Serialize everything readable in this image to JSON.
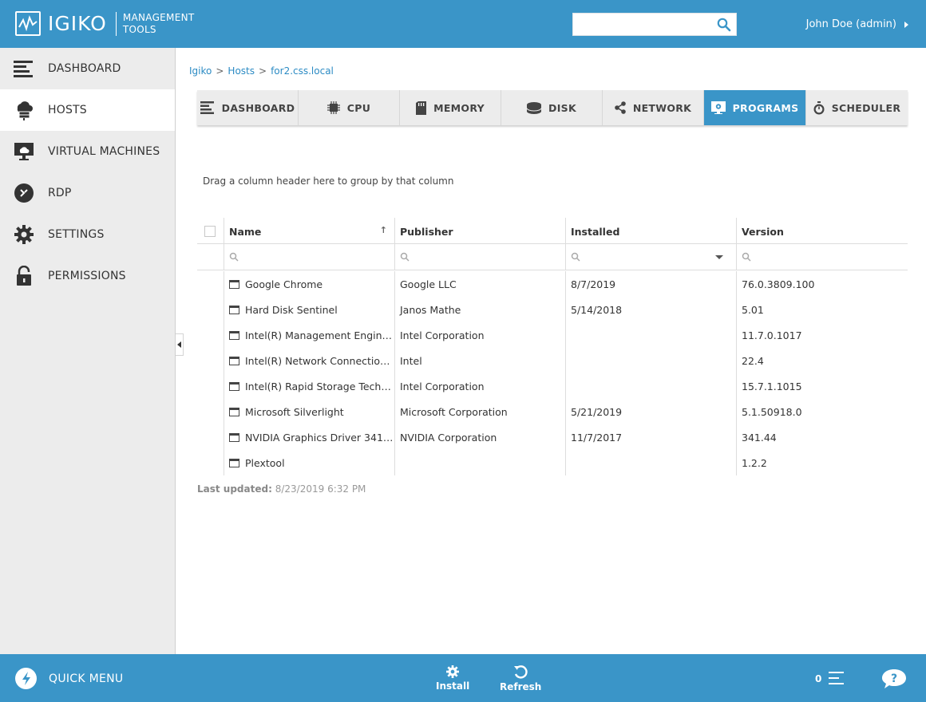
{
  "header": {
    "logo_text": "IGIKO",
    "logo_sub_line1": "MANAGEMENT",
    "logo_sub_line2": "TOOLS",
    "search_placeholder": "",
    "user": "John Doe (admin)"
  },
  "sidebar": {
    "items": [
      {
        "label": "DASHBOARD",
        "icon": "dashboard-icon",
        "active": false
      },
      {
        "label": "HOSTS",
        "icon": "hosts-icon",
        "active": true
      },
      {
        "label": "VIRTUAL MACHINES",
        "icon": "virtual-machines-icon",
        "active": false
      },
      {
        "label": "RDP",
        "icon": "rdp-icon",
        "active": false
      },
      {
        "label": "SETTINGS",
        "icon": "gear-icon",
        "active": false
      },
      {
        "label": "PERMISSIONS",
        "icon": "lock-icon",
        "active": false
      }
    ]
  },
  "breadcrumb": {
    "items": [
      "Igiko",
      "Hosts",
      "for2.css.local"
    ]
  },
  "tabs": [
    {
      "label": "DASHBOARD",
      "active": false
    },
    {
      "label": "CPU",
      "active": false
    },
    {
      "label": "MEMORY",
      "active": false
    },
    {
      "label": "DISK",
      "active": false
    },
    {
      "label": "NETWORK",
      "active": false
    },
    {
      "label": "PROGRAMS",
      "active": true
    },
    {
      "label": "SCHEDULER",
      "active": false
    }
  ],
  "grid": {
    "group_hint": "Drag a column header here to group by that column",
    "columns": [
      "Name",
      "Publisher",
      "Installed",
      "Version"
    ],
    "sort_indicator": "↑",
    "rows": [
      {
        "name": "Google Chrome",
        "publisher": "Google LLC",
        "installed": "8/7/2019",
        "version": "76.0.3809.100"
      },
      {
        "name": "Hard Disk Sentinel",
        "publisher": "Janos Mathe",
        "installed": "5/14/2018",
        "version": "5.01"
      },
      {
        "name": "Intel(R) Management Engin…",
        "publisher": "Intel Corporation",
        "installed": "",
        "version": "11.7.0.1017"
      },
      {
        "name": "Intel(R) Network Connectio…",
        "publisher": "Intel",
        "installed": "",
        "version": "22.4"
      },
      {
        "name": "Intel(R) Rapid Storage Tech…",
        "publisher": "Intel Corporation",
        "installed": "",
        "version": "15.7.1.1015"
      },
      {
        "name": "Microsoft Silverlight",
        "publisher": "Microsoft Corporation",
        "installed": "5/21/2019",
        "version": "5.1.50918.0"
      },
      {
        "name": "NVIDIA Graphics Driver 341…",
        "publisher": "NVIDIA Corporation",
        "installed": "11/7/2017",
        "version": "341.44"
      },
      {
        "name": "Plextool",
        "publisher": "",
        "installed": "",
        "version": "1.2.2"
      }
    ]
  },
  "footer_status": {
    "label": "Last updated:",
    "value": "8/23/2019 6:32 PM"
  },
  "bottombar": {
    "quick_menu": "QUICK MENU",
    "install": "Install",
    "refresh": "Refresh",
    "count": "0"
  },
  "colors": {
    "accent": "#3a95c8",
    "sidebar_bg": "#ececec"
  }
}
